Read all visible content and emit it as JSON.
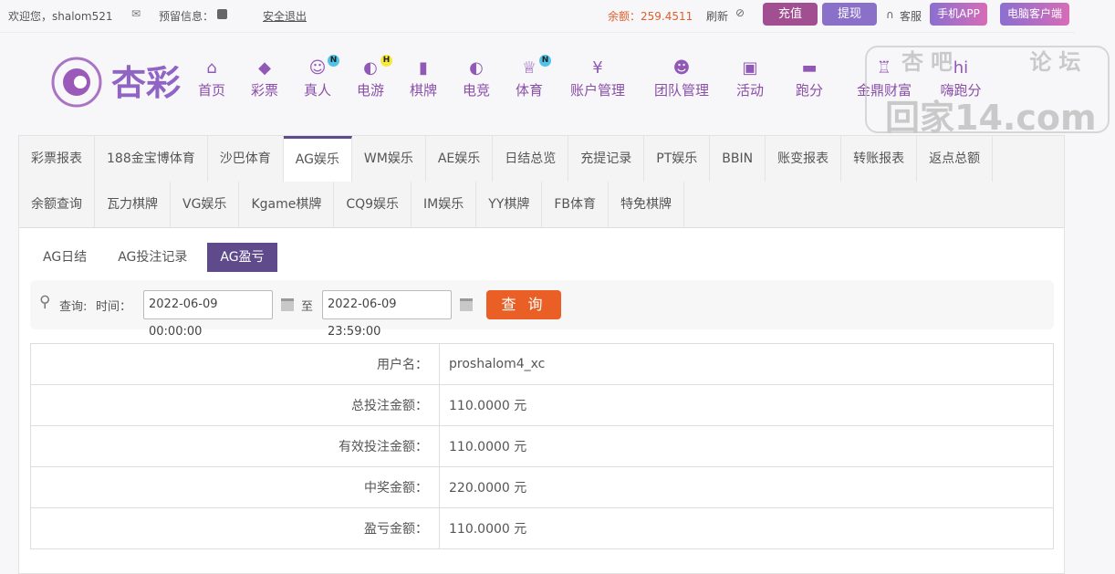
{
  "topbar": {
    "welcome": "欢迎您，shalom521",
    "reserved_info": "预留信息：",
    "logout": "安全退出",
    "balance": "余额：259.4511",
    "refresh": "刷新",
    "recharge": "充值",
    "withdraw": "提现",
    "service": "客服",
    "mobile_app": "手机APP",
    "pc_client": "电脑客户端"
  },
  "logo": {
    "text": "杏彩"
  },
  "nav": [
    {
      "label": "首页",
      "icon": "home-icon"
    },
    {
      "label": "彩票",
      "icon": "ticket-icon"
    },
    {
      "label": "真人",
      "icon": "dealer-icon",
      "badge": "N"
    },
    {
      "label": "电游",
      "icon": "gamepad-icon",
      "badge": "H"
    },
    {
      "label": "棋牌",
      "icon": "cards-icon"
    },
    {
      "label": "电竞",
      "icon": "gamepad-icon"
    },
    {
      "label": "体育",
      "icon": "trophy-icon",
      "badge": "N"
    },
    {
      "label": "账户管理",
      "icon": "yen-icon"
    },
    {
      "label": "团队管理",
      "icon": "team-icon"
    },
    {
      "label": "活动",
      "icon": "gift-icon"
    },
    {
      "label": "跑分",
      "icon": "rhino-icon"
    },
    {
      "label": "金鼎财富",
      "icon": "ding-icon"
    },
    {
      "label": "嗨跑分",
      "icon": "hi-icon"
    }
  ],
  "watermark": {
    "line1": "杏吧 论坛",
    "line2": "回家14.com"
  },
  "tabs_row1": [
    "彩票报表",
    "188金宝博体育",
    "沙巴体育",
    "AG娱乐",
    "WM娱乐",
    "AE娱乐",
    "日结总览",
    "充提记录",
    "PT娱乐",
    "BBIN",
    "账变报表",
    "转账报表",
    "返点总额"
  ],
  "tabs_row2": [
    "余额查询",
    "瓦力棋牌",
    "VG娱乐",
    "Kgame棋牌",
    "CQ9娱乐",
    "IM娱乐",
    "YY棋牌",
    "FB体育",
    "特免棋牌"
  ],
  "active_tab": "AG娱乐",
  "subtabs": [
    "AG日结",
    "AG投注记录",
    "AG盈亏"
  ],
  "query": {
    "label": "查询:",
    "time_label": "时间：",
    "start": "2022-06-09 00:00:00",
    "to": "至",
    "end": "2022-06-09 23:59:00",
    "button": "查 询"
  },
  "result": [
    {
      "label": "用户名：",
      "value": "proshalom4_xc"
    },
    {
      "label": "总投注金额：",
      "value": "110.0000 元"
    },
    {
      "label": "有效投注金额：",
      "value": "110.0000 元"
    },
    {
      "label": "中奖金额：",
      "value": "220.0000 元"
    },
    {
      "label": "盈亏金额：",
      "value": "110.0000 元"
    }
  ],
  "colors": {
    "accent": "#5f4b8b",
    "query_button": "#ea5f26",
    "balance": "#e0602c"
  }
}
